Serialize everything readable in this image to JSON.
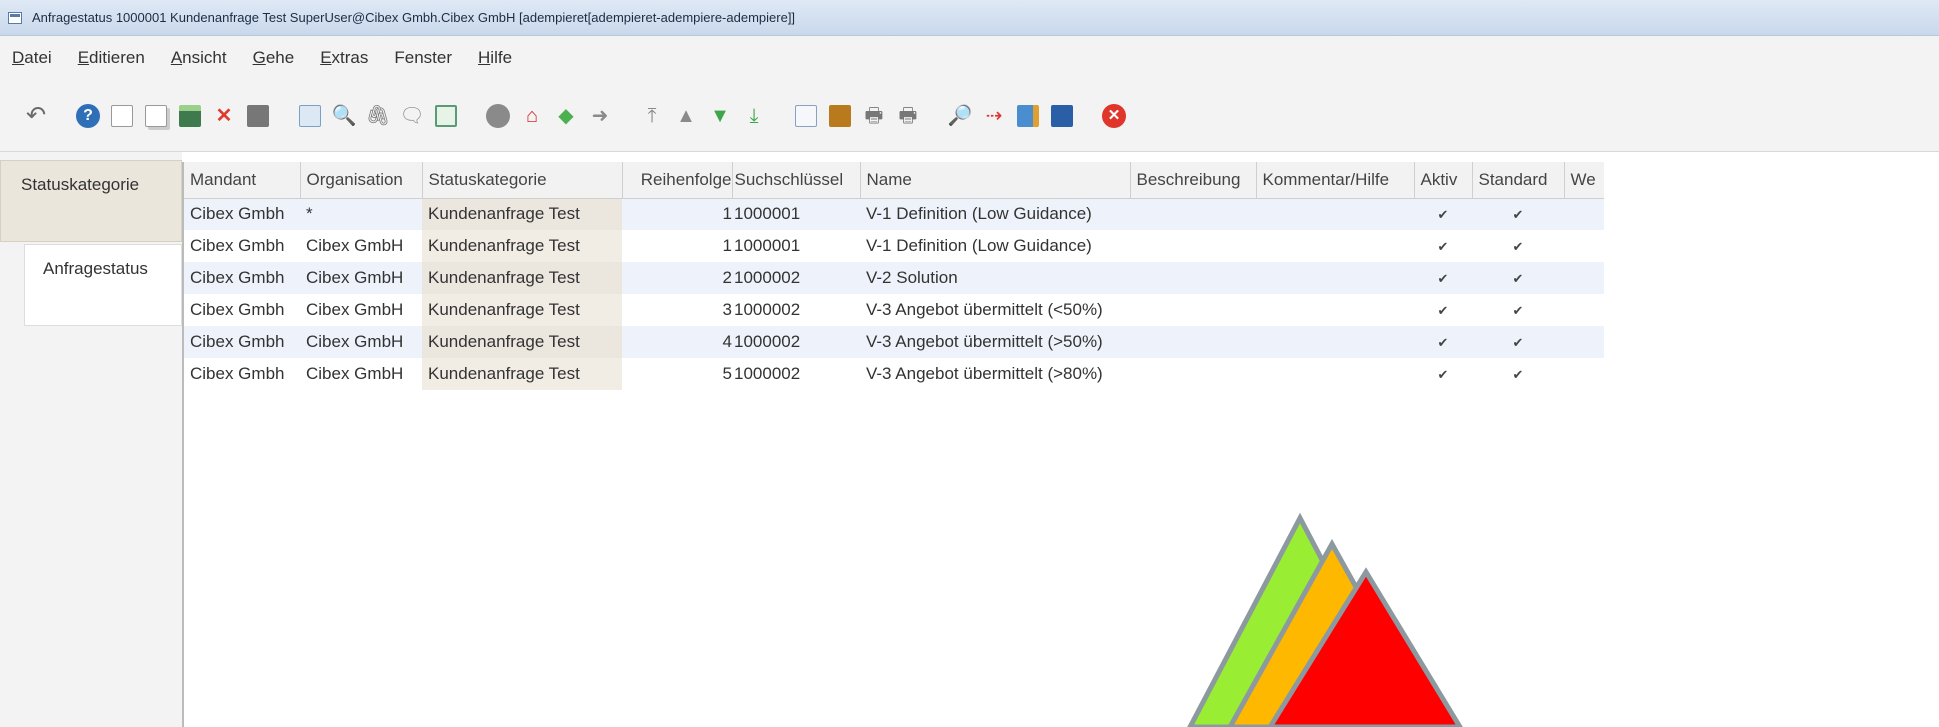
{
  "window": {
    "title": "Anfragestatus  1000001  Kundenanfrage Test  SuperUser@Cibex Gmbh.Cibex GmbH [adempieret[adempieret-adempiere-adempiere]]"
  },
  "menu": {
    "items": [
      {
        "first": "D",
        "rest": "atei"
      },
      {
        "first": "E",
        "rest": "ditieren"
      },
      {
        "first": "A",
        "rest": "nsicht"
      },
      {
        "first": "G",
        "rest": "ehe"
      },
      {
        "first": "E",
        "rest": "xtras"
      },
      {
        "first": "",
        "rest": "Fenster"
      },
      {
        "first": "H",
        "rest": "ilfe"
      }
    ]
  },
  "toolbar": {
    "icons": [
      "undo-icon",
      "help-icon",
      "new-record-icon",
      "copy-record-icon",
      "save-icon",
      "delete-icon",
      "delete-selection-icon",
      "refresh-icon",
      "find-icon",
      "attachment-icon",
      "chat-icon",
      "grid-toggle-icon",
      "history-icon",
      "home-icon",
      "parent-icon",
      "detail-icon",
      "first-record-icon",
      "previous-record-icon",
      "next-record-icon",
      "last-record-icon",
      "report-icon",
      "archive-icon",
      "print-preview-icon",
      "print-icon",
      "zoom-across-icon",
      "workflow-icon",
      "request-icon",
      "product-info-icon",
      "close-window-icon"
    ]
  },
  "sidetabs": {
    "active": "Statuskategorie",
    "inactive": "Anfragestatus"
  },
  "grid": {
    "columns": [
      "Mandant",
      "Organisation",
      "Statuskategorie",
      "Reihenfolge",
      "Suchschlüssel",
      "Name",
      "Beschreibung",
      "Kommentar/Hilfe",
      "Aktiv",
      "Standard",
      "We"
    ],
    "rows": [
      {
        "mandant": "Cibex Gmbh",
        "org": "*",
        "kategorie": "Kundenanfrage Test",
        "reihenfolge": "1",
        "key": "1000001",
        "name": "V-1 Definition (Low Guidance)",
        "aktiv": "✔",
        "standard": "✔"
      },
      {
        "mandant": "Cibex Gmbh",
        "org": "Cibex GmbH",
        "kategorie": "Kundenanfrage Test",
        "reihenfolge": "1",
        "key": "1000001",
        "name": "V-1 Definition (Low Guidance)",
        "aktiv": "✔",
        "standard": "✔"
      },
      {
        "mandant": "Cibex Gmbh",
        "org": "Cibex GmbH",
        "kategorie": "Kundenanfrage Test",
        "reihenfolge": "2",
        "key": "1000002",
        "name": "V-2 Solution",
        "aktiv": "✔",
        "standard": "✔"
      },
      {
        "mandant": "Cibex Gmbh",
        "org": "Cibex GmbH",
        "kategorie": "Kundenanfrage Test",
        "reihenfolge": "3",
        "key": "1000002",
        "name": "V-3 Angebot übermittelt (<50%)",
        "aktiv": "✔",
        "standard": "✔"
      },
      {
        "mandant": "Cibex Gmbh",
        "org": "Cibex GmbH",
        "kategorie": "Kundenanfrage Test",
        "reihenfolge": "4",
        "key": "1000002",
        "name": "V-3 Angebot übermittelt (>50%)",
        "aktiv": "✔",
        "standard": "✔"
      },
      {
        "mandant": "Cibex Gmbh",
        "org": "Cibex GmbH",
        "kategorie": "Kundenanfrage Test",
        "reihenfolge": "5",
        "key": "1000002",
        "name": "V-3 Angebot übermittelt (>80%)",
        "aktiv": "✔",
        "standard": "✔"
      }
    ]
  },
  "colors": {
    "logo_green": "#99ee33",
    "logo_orange": "#ffb800",
    "logo_red": "#ff0000",
    "logo_border": "#8c9aa0"
  }
}
